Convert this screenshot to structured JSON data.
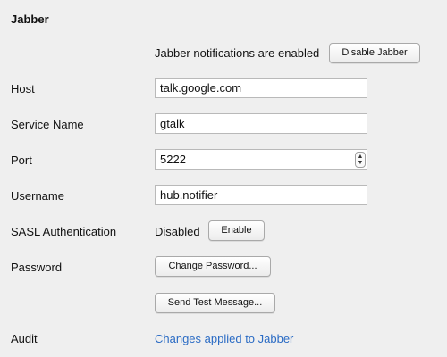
{
  "section": {
    "title": "Jabber"
  },
  "notifications": {
    "status_text": "Jabber notifications are enabled",
    "disable_button": "Disable Jabber"
  },
  "host": {
    "label": "Host",
    "value": "talk.google.com"
  },
  "service_name": {
    "label": "Service Name",
    "value": "gtalk"
  },
  "port": {
    "label": "Port",
    "value": "5222"
  },
  "username": {
    "label": "Username",
    "value": "hub.notifier"
  },
  "sasl": {
    "label": "SASL Authentication",
    "status": "Disabled",
    "enable_button": "Enable"
  },
  "password": {
    "label": "Password",
    "change_button": "Change Password..."
  },
  "test_message": {
    "button": "Send Test Message..."
  },
  "audit": {
    "label": "Audit",
    "link_text": "Changes applied to Jabber",
    "link_color": "#2a6bc4"
  },
  "icons": {
    "port_stepper": "stepper-icon"
  }
}
